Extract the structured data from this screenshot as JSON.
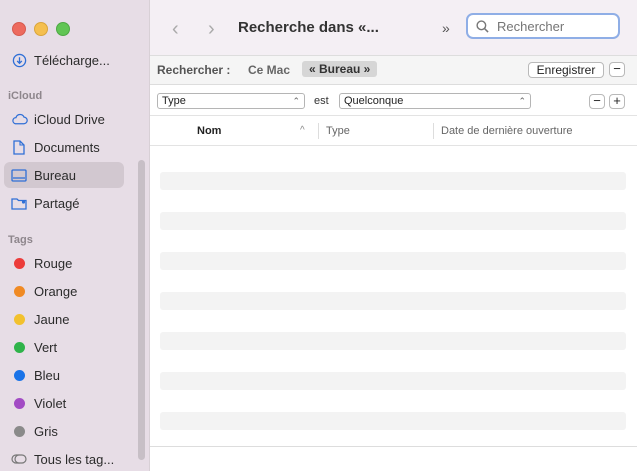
{
  "window": {
    "title": "Recherche dans «..."
  },
  "toolbar": {
    "back_glyph": "‹",
    "forward_glyph": "›",
    "more_glyph": "»",
    "search_placeholder": "Rechercher"
  },
  "sidebar": {
    "top_items": [
      {
        "label": "Télécharge...",
        "icon": "download-icon"
      }
    ],
    "icloud_header": "iCloud",
    "icloud_items": [
      {
        "label": "iCloud Drive",
        "icon": "cloud-icon"
      },
      {
        "label": "Documents",
        "icon": "document-icon"
      },
      {
        "label": "Bureau",
        "icon": "desktop-icon",
        "selected": true
      },
      {
        "label": "Partagé",
        "icon": "shared-folder-icon"
      }
    ],
    "tags_header": "Tags",
    "tags": [
      {
        "label": "Rouge",
        "color": "#ec3c3a"
      },
      {
        "label": "Orange",
        "color": "#f08a24"
      },
      {
        "label": "Jaune",
        "color": "#f2c12e"
      },
      {
        "label": "Vert",
        "color": "#2fb34a"
      },
      {
        "label": "Bleu",
        "color": "#1a73e8"
      },
      {
        "label": "Violet",
        "color": "#a24bc4"
      },
      {
        "label": "Gris",
        "color": "#8a8a8a"
      }
    ],
    "all_tags": {
      "label": "Tous les tag...",
      "icon": "tags-icon"
    }
  },
  "scope": {
    "label": "Rechercher :",
    "this_mac": "Ce Mac",
    "current": "« Bureau »",
    "save_label": "Enregistrer",
    "remove_glyph": "−"
  },
  "criteria": {
    "attribute": "Type",
    "operator": "est",
    "value": "Quelconque",
    "remove_glyph": "−",
    "add_glyph": "+"
  },
  "columns": {
    "name": "Nom",
    "type": "Type",
    "last_opened": "Date de dernière ouverture"
  }
}
